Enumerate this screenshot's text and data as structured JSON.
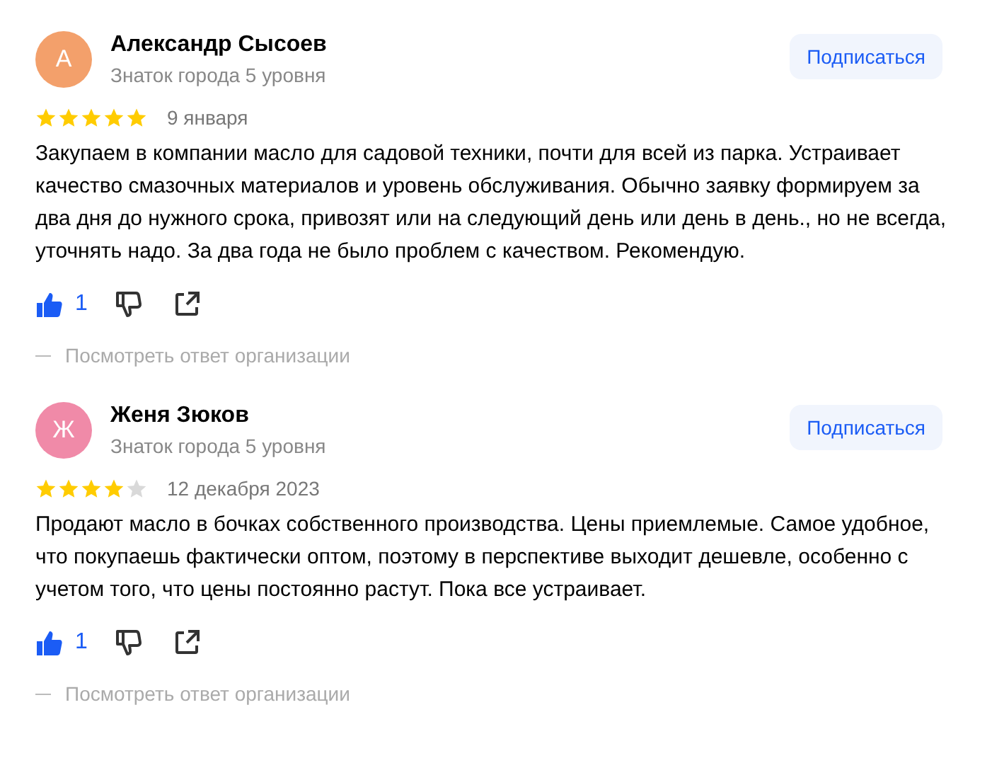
{
  "reviews": [
    {
      "avatar_letter": "А",
      "color": "#f3a06b",
      "name": "Александр Сысоев",
      "subtitle": "Знаток города 5 уровня",
      "subscribe": "Подписаться",
      "stars": 5,
      "date": "9 января",
      "text": "Закупаем в компании масло для садовой техники, почти для всей из парка. Устраивает качество смазочных материалов и уровень обслуживания. Обычно заявку формируем за два дня до нужного срока, привозят или на следующий день или день в день., но не всегда, уточнять надо. За два года не было проблем с качеством. Рекомендую.",
      "liked": true,
      "likes": "1",
      "answer_link": "Посмотреть ответ организации"
    },
    {
      "avatar_letter": "Ж",
      "color": "#f08aa8",
      "name": "Женя Зюков",
      "subtitle": "Знаток города 5 уровня",
      "subscribe": "Подписаться",
      "stars": 4,
      "date": "12 декабря 2023",
      "text": "Продают масло в бочках собственного производства. Цены приемлемые. Самое удобное, что покупаешь фактически оптом, поэтому в перспективе выходит дешевле, особенно с учетом того, что цены постоянно растут. Пока все устраивает.",
      "liked": true,
      "likes": "1",
      "answer_link": "Посмотреть ответ организации"
    }
  ]
}
